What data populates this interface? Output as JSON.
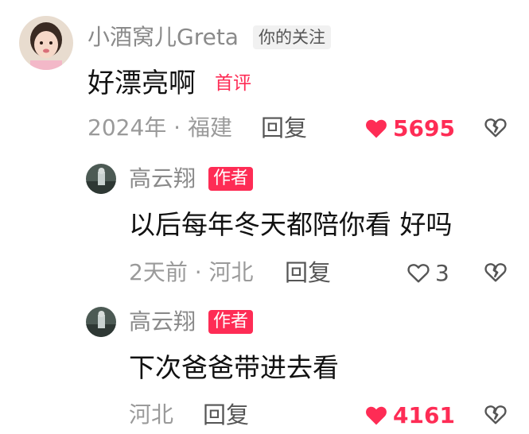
{
  "comment_1": {
    "username": "小酒窝儿Greta",
    "follow_tag": "你的关注",
    "text": "好漂亮啊",
    "first_tag": "首评",
    "meta": "2024年 · 福建",
    "reply_label": "回复",
    "like_count": "5695",
    "liked": true
  },
  "replies": [
    {
      "username": "高云翔",
      "author_tag": "作者",
      "text": "以后每年冬天都陪你看 好吗",
      "meta": "2天前 · 河北",
      "reply_label": "回复",
      "like_count": "3",
      "liked": false
    },
    {
      "username": "高云翔",
      "author_tag": "作者",
      "text": "下次爸爸带进去看",
      "meta": "河北",
      "reply_label": "回复",
      "like_count": "4161",
      "liked": true
    }
  ],
  "colors": {
    "accent": "#fe2c55",
    "muted_text": "#9a9a9a",
    "body_text": "#111111"
  },
  "icons": {
    "like": "heart-icon",
    "dislike": "broken-heart-icon"
  }
}
